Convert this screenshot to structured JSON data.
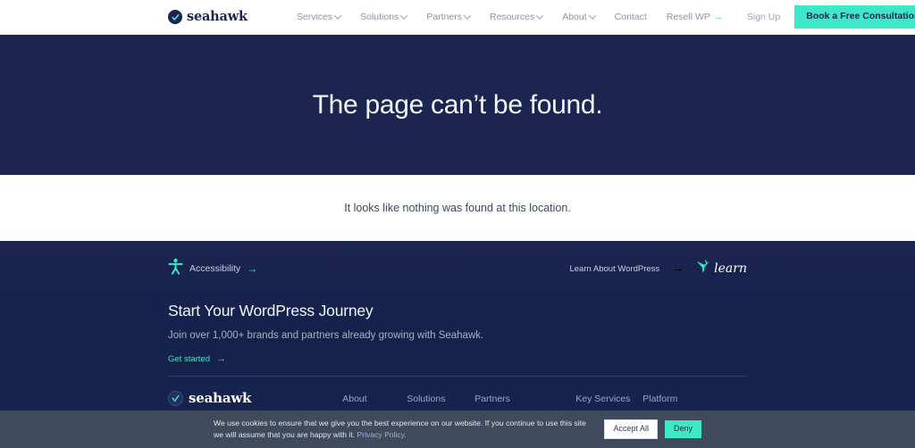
{
  "brand": {
    "name": "seahawk",
    "mark_icon": "check-circle-icon"
  },
  "header": {
    "nav": [
      {
        "label": "Services",
        "has_caret": true
      },
      {
        "label": "Solutions",
        "has_caret": true
      },
      {
        "label": "Partners",
        "has_caret": true
      },
      {
        "label": "Resources",
        "has_caret": true
      },
      {
        "label": "About",
        "has_caret": true
      },
      {
        "label": "Contact",
        "has_caret": false
      },
      {
        "label": "Resell WP",
        "has_caret": false,
        "arrow": "→"
      }
    ],
    "sign_up": "Sign Up",
    "cta": "Book a Free Consultation",
    "cta_color": "#3ce8c8"
  },
  "hero": {
    "title": "The page can’t be found.",
    "background": "#1b2550"
  },
  "content": {
    "message": "It looks like nothing was found at this location."
  },
  "footer": {
    "accessibility": {
      "label": "Accessibility",
      "icon": "accessibility-person-icon",
      "arrow": "→"
    },
    "learn": {
      "label": "Learn About WordPress",
      "arrow": "→",
      "logo_word": "learn",
      "logo_icon": "wordpress-learn-bird-icon"
    },
    "cta_heading": "Start Your WordPress Journey",
    "cta_sub": "Join over 1,000+ brands and partners already growing with Seahawk.",
    "get_started": {
      "label": "Get started",
      "arrow": "→"
    },
    "links": [
      "About",
      "Solutions",
      "Partners",
      "Key Services",
      "Platform"
    ],
    "accent_color": "#3ce8c8"
  },
  "cookie": {
    "text_line1": "We use cookies to ensure that we give you the best experience on our website. If you continue to use this site we",
    "text_line2": "will assume that you are happy with it.",
    "privacy_link": "Privacy Policy.",
    "accept_label": "Accept All",
    "deny_label": "Deny",
    "background": "#3f4a5c"
  }
}
